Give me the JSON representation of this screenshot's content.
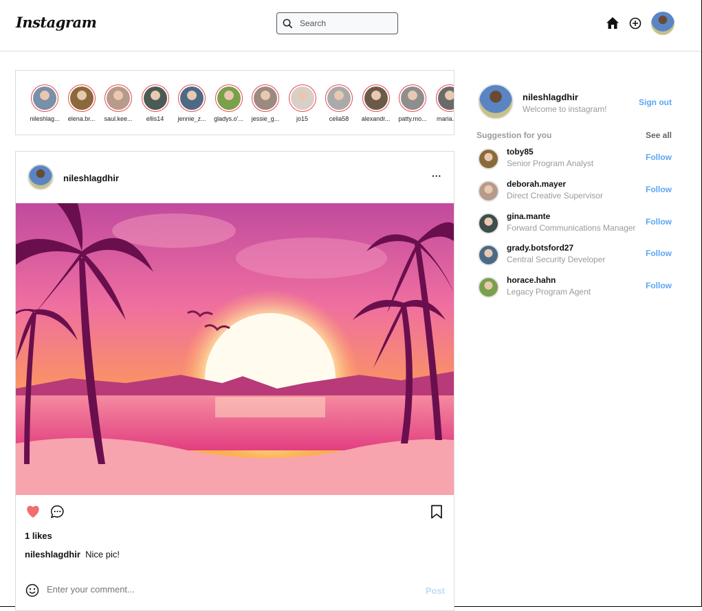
{
  "header": {
    "logo": "Instagram",
    "search_placeholder": "Search",
    "icons": [
      "home-icon",
      "plus-circle-icon",
      "profile-avatar"
    ]
  },
  "stories": [
    {
      "user": "nileshlag...",
      "color": "#7a8fa8"
    },
    {
      "user": "elena.br...",
      "color": "#8a6a3a"
    },
    {
      "user": "saul.kee...",
      "color": "#b89a8a"
    },
    {
      "user": "ellis14",
      "color": "#4b5a55"
    },
    {
      "user": "jennie_z...",
      "color": "#4c6a85"
    },
    {
      "user": "gladys.o'...",
      "color": "#7aa04a"
    },
    {
      "user": "jessie_g...",
      "color": "#9a8a80"
    },
    {
      "user": "jo15",
      "color": "#d8d0c8"
    },
    {
      "user": "celia58",
      "color": "#aaaaaa"
    },
    {
      "user": "alexandr...",
      "color": "#6a5a48"
    },
    {
      "user": "patty.mo...",
      "color": "#8e8e8e"
    },
    {
      "user": "maria.fi...",
      "color": "#6a6a6a"
    }
  ],
  "post": {
    "username": "nileshlagdhir",
    "more": "···",
    "likes": "1 likes",
    "caption_user": "nileshlagdhir",
    "caption_text": "Nice pic!",
    "comment_placeholder": "Enter your comment...",
    "post_label": "Post",
    "liked": true
  },
  "sidebar": {
    "username": "nileshlagdhir",
    "welcome": "Welcome to instagram!",
    "signout": "Sign out",
    "suggestion_title": "Suggestion for you",
    "see_all": "See all",
    "suggestions": [
      {
        "name": "toby85",
        "title": "Senior Program Analyst",
        "follow": "Follow",
        "color": "#8a6a3a"
      },
      {
        "name": "deborah.mayer",
        "title": "Direct Creative Supervisor",
        "follow": "Follow",
        "color": "#b89a8a"
      },
      {
        "name": "gina.mante",
        "title": "Forward Communications Manager",
        "follow": "Follow",
        "color": "#3e4e4a"
      },
      {
        "name": "grady.botsford27",
        "title": "Central Security Developer",
        "follow": "Follow",
        "color": "#4c6a85"
      },
      {
        "name": "horace.hahn",
        "title": "Legacy Program Agent",
        "follow": "Follow",
        "color": "#7aa04a"
      }
    ]
  },
  "colors": {
    "accent": "#5aa6f5",
    "story_ring": "#e8434a",
    "like": "#f26d6d"
  }
}
